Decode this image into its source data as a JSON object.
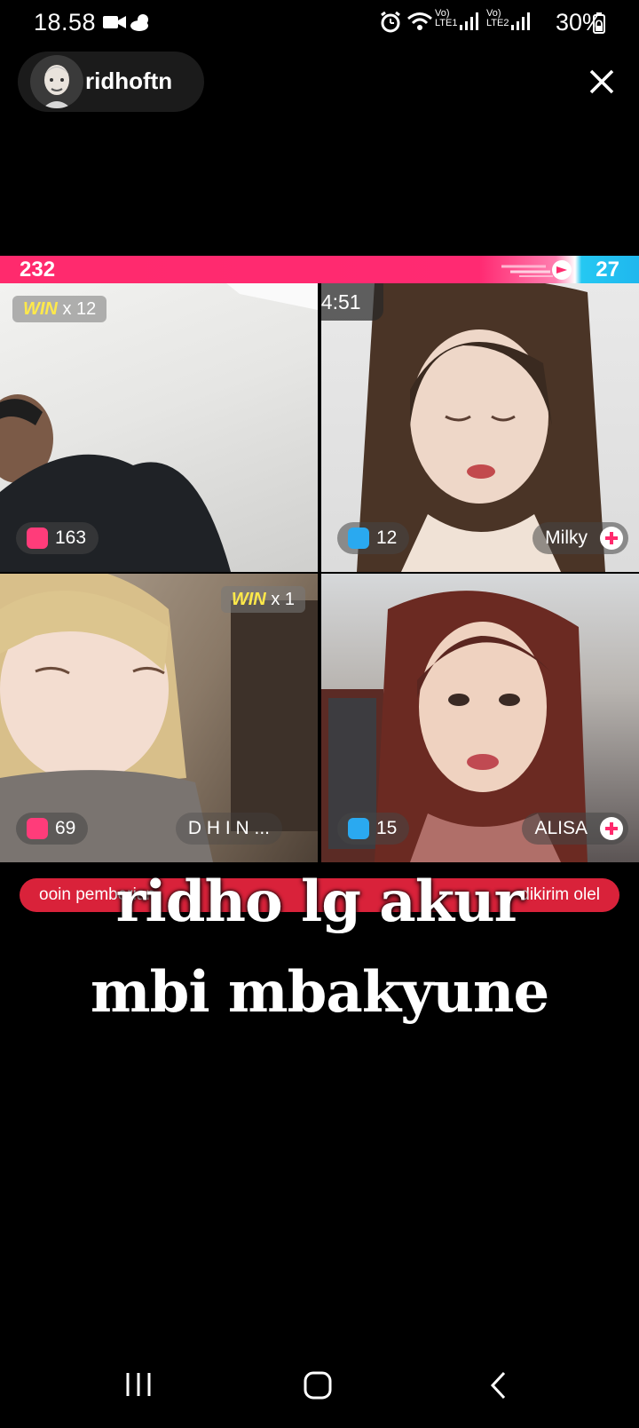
{
  "status_bar": {
    "time": "18.58",
    "battery_percent": "30%",
    "sim1_label": "LTE1",
    "sim2_label": "LTE2",
    "icons": [
      "video-camera-icon",
      "weather-icon",
      "alarm-icon",
      "wifi-icon",
      "signal-icon",
      "battery-icon"
    ]
  },
  "profile": {
    "username": "ridhoftn"
  },
  "battle": {
    "score_left": "232",
    "score_right": "27",
    "timer": "04:51",
    "accent_pink": "#ff2a6d",
    "accent_blue": "#1fb7ee"
  },
  "tiles": [
    {
      "win_prefix": "WIN",
      "win_count": "x 12",
      "score": "163",
      "team": "pink"
    },
    {
      "score": "12",
      "name": "Milky",
      "team": "blue"
    },
    {
      "win_prefix": "WIN",
      "win_count": "x 1",
      "score": "69",
      "name": "D H I N ...",
      "team": "pink"
    },
    {
      "score": "15",
      "name": "ALISA",
      "team": "blue"
    }
  ],
  "banner": {
    "left_text": "ooin pemberian",
    "right_text": "dikirim olel"
  },
  "caption": {
    "line1": "ridho lg akur",
    "line2": "mbi mbakyune"
  }
}
